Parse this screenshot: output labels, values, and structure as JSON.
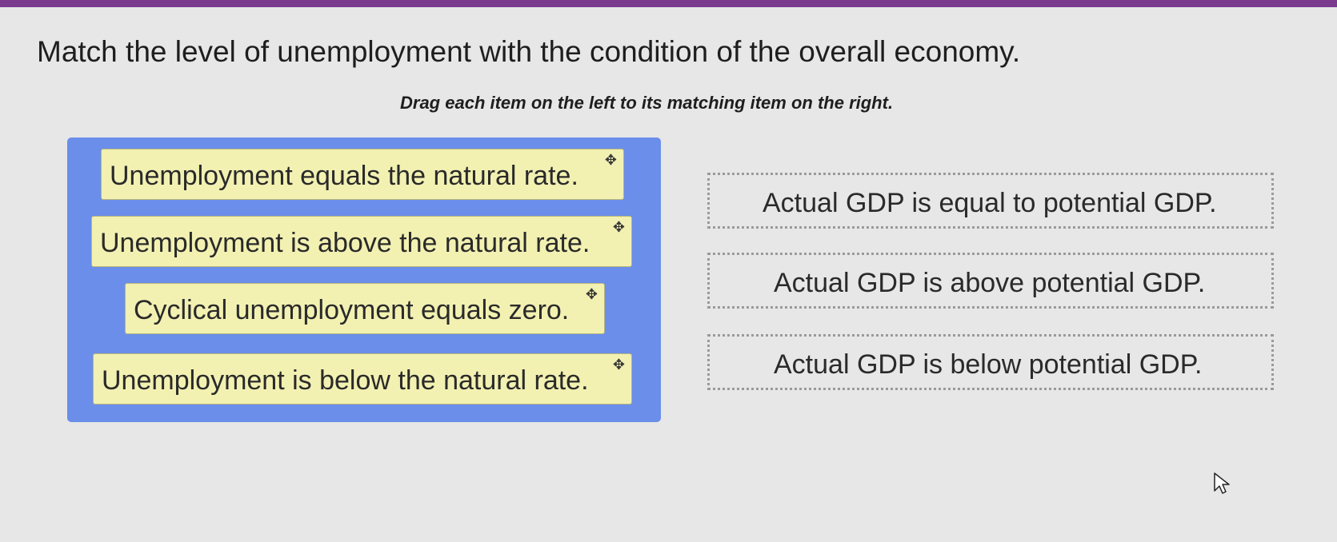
{
  "question": {
    "title": "Match the level of unemployment with the condition of the overall economy.",
    "instructions": "Drag each item on the left to its matching item on the right."
  },
  "left_items": [
    {
      "label": "Unemployment equals the natural rate.",
      "icon": "move-icon"
    },
    {
      "label": "Unemployment is above the natural rate.",
      "icon": "move-icon"
    },
    {
      "label": "Cyclical unemployment equals zero.",
      "icon": "move-icon"
    },
    {
      "label": "Unemployment is below the natural rate.",
      "icon": "move-icon"
    }
  ],
  "right_targets": [
    {
      "label": "Actual GDP is equal to potential GDP."
    },
    {
      "label": "Actual GDP is above potential GDP."
    },
    {
      "label": "Actual GDP is below potential GDP."
    }
  ],
  "colors": {
    "top_bar": "#7a3b8f",
    "panel": "#6b8eea",
    "item": "#f2f1b2",
    "background": "#e6e7e6"
  }
}
